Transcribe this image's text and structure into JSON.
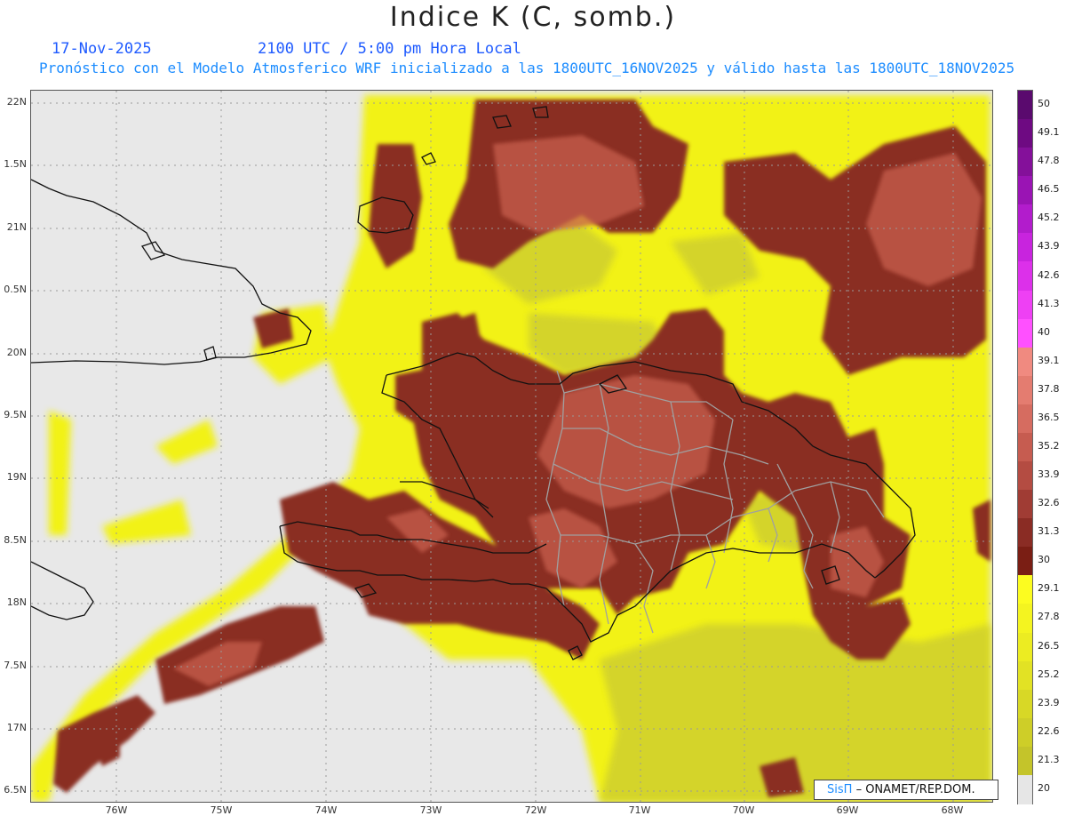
{
  "header": {
    "title": "Indice K (C, somb.)",
    "date": "17-Nov-2025",
    "time": "2100 UTC / 5:00 pm Hora Local",
    "model_line": "Pronóstico con el Modelo Atmosferico WRF inicializado a las 1800UTC_16NOV2025 y válido hasta las  1800UTC_18NOV2025"
  },
  "map": {
    "lat_labels": [
      "22N",
      "1.5N",
      "21N",
      "0.5N",
      "20N",
      "9.5N",
      "19N",
      "8.5N",
      "18N",
      "7.5N",
      "17N",
      "6.5N"
    ],
    "lon_labels": [
      "76W",
      "75W",
      "74W",
      "73W",
      "72W",
      "71W",
      "70W",
      "69W",
      "68W"
    ],
    "colors": {
      "land_background": "#e8e8e8",
      "gridline": "#9a9a9a",
      "coastline": "#111111",
      "province_border": "#a0a0a0"
    }
  },
  "colorbar": {
    "labels": [
      "50",
      "49.1",
      "47.8",
      "46.5",
      "45.2",
      "43.9",
      "42.6",
      "41.3",
      "40",
      "39.1",
      "37.8",
      "36.5",
      "35.2",
      "33.9",
      "32.6",
      "31.3",
      "30",
      "29.1",
      "27.8",
      "26.5",
      "25.2",
      "23.9",
      "22.6",
      "21.3",
      "20"
    ],
    "colors": [
      "#5a0a6e",
      "#6e0a82",
      "#84109a",
      "#9a14b4",
      "#b21ccc",
      "#c824de",
      "#dc30ea",
      "#ee40f4",
      "#ff50ff",
      "#f08a80",
      "#e47c70",
      "#d66c60",
      "#c65c50",
      "#b44c42",
      "#a03c34",
      "#8a2c24",
      "#7a1e14",
      "#fcfc20",
      "#f4f420",
      "#ecec22",
      "#e2e224",
      "#d8d826",
      "#cece28",
      "#c4c42a",
      "#e6e6e6"
    ]
  },
  "credit": {
    "logo": "SisΠ",
    "org": "– ONAMET/REP.DOM."
  }
}
